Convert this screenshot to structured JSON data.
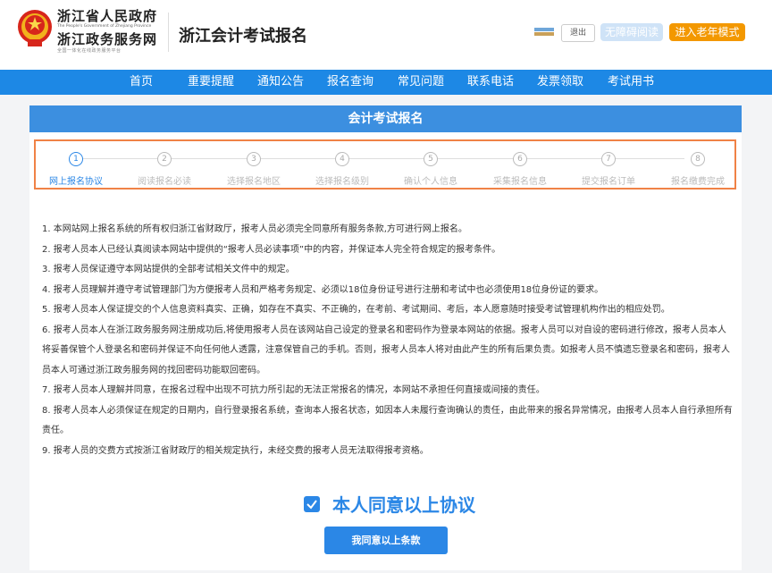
{
  "header": {
    "gov_name": "浙江省人民政府",
    "gov_name_en": "The People's Government of Zhejiang Province",
    "service_name": "浙江政务服务网",
    "service_slogan": "全国一体化在线政务服务平台",
    "site_title": "浙江会计考试报名",
    "logout_label": "退出",
    "accessible_label": "无障碍阅读",
    "elder_mode_label": "进入老年模式"
  },
  "nav": {
    "items": [
      "首页",
      "重要提醒",
      "通知公告",
      "报名查询",
      "常见问题",
      "联系电话",
      "发票领取",
      "考试用书"
    ]
  },
  "panel": {
    "title": "会计考试报名"
  },
  "steps": [
    {
      "num": "1",
      "label": "网上报名协议",
      "active": true
    },
    {
      "num": "2",
      "label": "阅读报名必读",
      "active": false
    },
    {
      "num": "3",
      "label": "选择报名地区",
      "active": false
    },
    {
      "num": "4",
      "label": "选择报名级别",
      "active": false
    },
    {
      "num": "5",
      "label": "确认个人信息",
      "active": false
    },
    {
      "num": "6",
      "label": "采集报名信息",
      "active": false
    },
    {
      "num": "7",
      "label": "提交报名订单",
      "active": false
    },
    {
      "num": "8",
      "label": "报名缴费完成",
      "active": false
    }
  ],
  "terms": [
    "1. 本网站网上报名系统的所有权归浙江省财政厅，报考人员必须完全同意所有服务条款,方可进行网上报名。",
    "2. 报考人员本人已经认真阅读本网站中提供的“报考人员必读事项”中的内容，并保证本人完全符合规定的报考条件。",
    "3. 报考人员保证遵守本网站提供的全部考试相关文件中的规定。",
    "4. 报考人员理解并遵守考试管理部门为方便报考人员和严格考务规定、必须以18位身份证号进行注册和考试中也必须使用18位身份证的要求。",
    "5. 报考人员本人保证提交的个人信息资料真实、正确，如存在不真实、不正确的，在考前、考试期间、考后，本人愿意随时接受考试管理机构作出的相应处罚。",
    "6. 报考人员本人在浙江政务服务网注册成功后,将使用报考人员在该网站自己设定的登录名和密码作为登录本网站的依据。报考人员可以对自设的密码进行修改，报考人员本人将妥善保管个人登录名和密码并保证不向任何他人透露，注意保管自己的手机。否则，报考人员本人将对由此产生的所有后果负责。如报考人员不慎遗忘登录名和密码，报考人员本人可通过浙江政务服务网的找回密码功能取回密码。",
    "7. 报考人员本人理解并同意，在报名过程中出现不可抗力所引起的无法正常报名的情况，本网站不承担任何直接或间接的责任。",
    "8. 报考人员本人必须保证在规定的日期内，自行登录报名系统，查询本人报名状态，如因本人未履行查询确认的责任，由此带来的报名异常情况，由报考人员本人自行承担所有责任。",
    "9. 报考人员的交费方式按浙江省财政厅的相关规定执行，未经交费的报考人员无法取得报考资格。"
  ],
  "agreement": {
    "checked": true,
    "label": "本人同意以上协议",
    "submit_label": "我同意以上条款"
  },
  "colors": {
    "nav_blue": "#1d88e5",
    "accent_blue": "#2b87e6",
    "orange": "#f39800",
    "step_border": "#f08246"
  }
}
